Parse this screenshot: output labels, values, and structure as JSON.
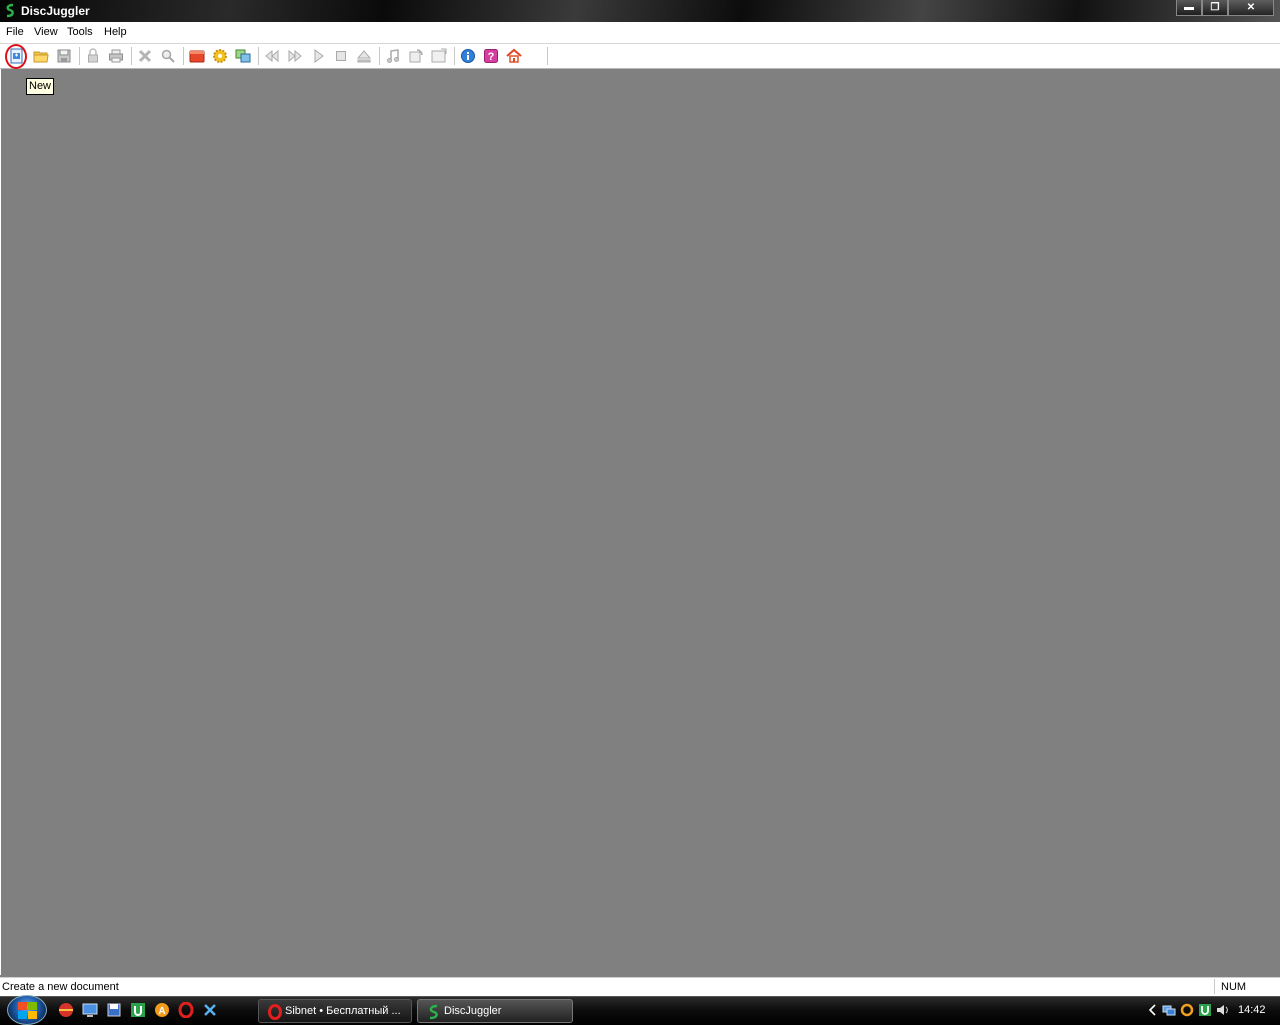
{
  "window": {
    "title": "DiscJuggler"
  },
  "menu": {
    "file": "File",
    "view": "View",
    "tools": "Tools",
    "help": "Help"
  },
  "toolbar": {
    "buttons": [
      "new-icon",
      "open-icon",
      "save-icon",
      "lock-icon",
      "print-icon",
      "delete-icon",
      "find-icon",
      "media-icon",
      "gear-icon",
      "copy-disc-icon",
      "rewind-icon",
      "fast-forward-icon",
      "play-icon",
      "stop-icon",
      "eject-icon",
      "audio-icon",
      "refresh-icon",
      "disc-info-icon",
      "info-icon",
      "help-icon",
      "home-icon"
    ]
  },
  "tooltip": {
    "text": "New"
  },
  "status": {
    "message": "Create a new document",
    "num": "NUM"
  },
  "taskbar": {
    "tasks": [
      {
        "label": "Sibnet • Бесплатный ..."
      },
      {
        "label": "DiscJuggler"
      }
    ],
    "clock": "14:42"
  },
  "colors": {
    "accent": "#e0101a",
    "brand_green": "#2ab34a",
    "workspace": "#808080"
  }
}
